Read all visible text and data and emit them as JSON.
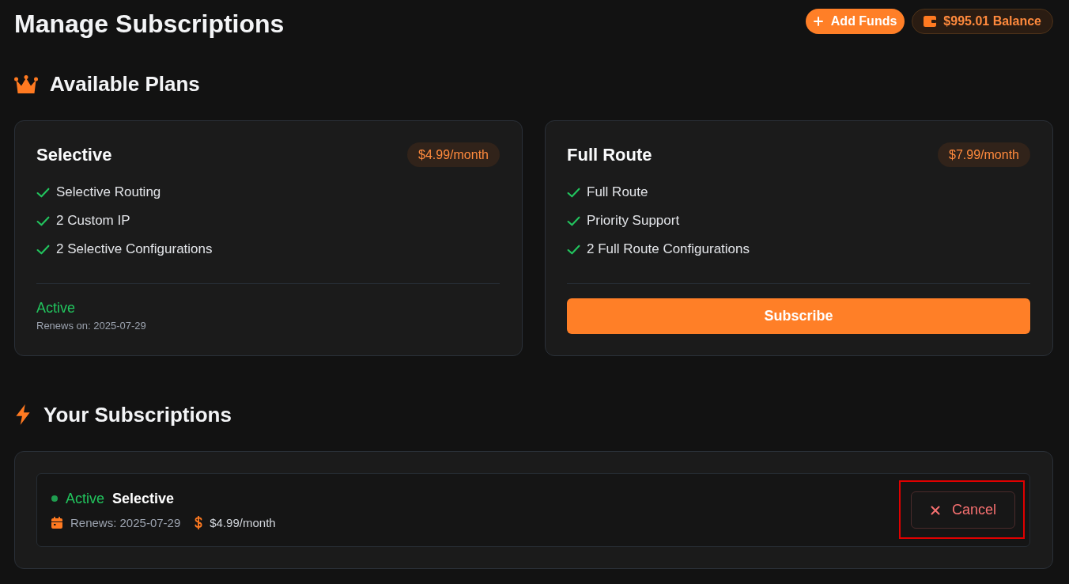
{
  "header": {
    "title": "Manage Subscriptions",
    "add_funds_button": "Add Funds",
    "balance": "$995.01 Balance"
  },
  "available_plans": {
    "title": "Available Plans",
    "plans": [
      {
        "kind": "active",
        "name": "Selective",
        "price": "$4.99/month",
        "features": [
          "Selective Routing",
          "2 Custom IP",
          "2 Selective Configurations"
        ],
        "status_label": "Active",
        "renews": "Renews on: 2025-07-29"
      },
      {
        "kind": "subscribe",
        "name": "Full Route",
        "price": "$7.99/month",
        "features": [
          "Full Route",
          "Priority Support",
          "2 Full Route Configurations"
        ],
        "action_label": "Subscribe"
      }
    ]
  },
  "your_subscriptions": {
    "title": "Your Subscriptions",
    "items": [
      {
        "status": "Active",
        "plan": "Selective",
        "renews": "Renews: 2025-07-29",
        "price": "$4.99/month",
        "cancel_button": "Cancel",
        "highlighted": true
      }
    ]
  }
}
